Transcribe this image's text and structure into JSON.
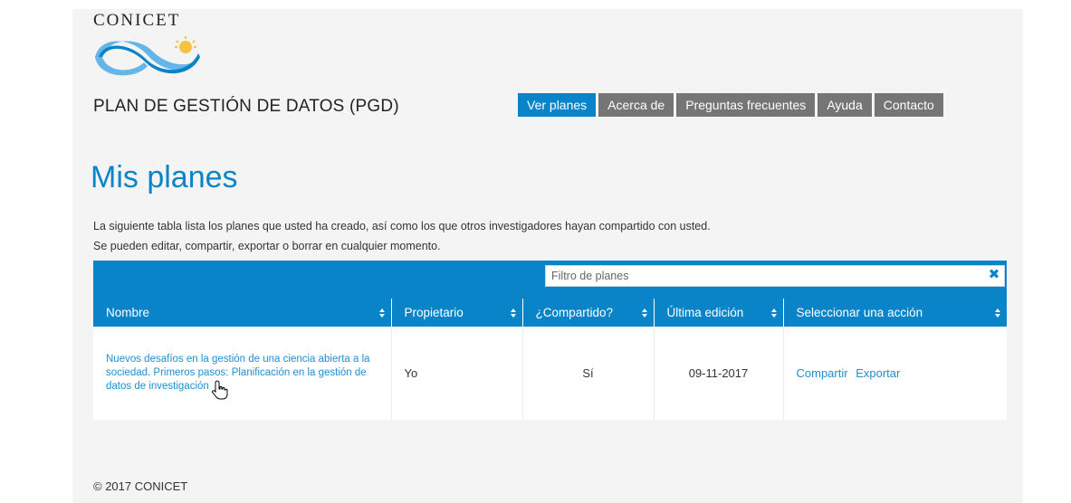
{
  "header": {
    "brand": "CONICET",
    "site_title": "PLAN DE GESTIÓN DE DATOS (PGD)",
    "nav": [
      {
        "label": "Ver planes",
        "active": true
      },
      {
        "label": "Acerca de",
        "active": false
      },
      {
        "label": "Preguntas frecuentes",
        "active": false
      },
      {
        "label": "Ayuda",
        "active": false
      },
      {
        "label": "Contacto",
        "active": false
      }
    ]
  },
  "main": {
    "title": "Mis planes",
    "intro_line1": "La siguiente tabla lista los planes que usted ha creado, así como los que otros investigadores hayan compartido con usted.",
    "intro_line2": "Se pueden editar, compartir, exportar o borrar en cualquier momento."
  },
  "table": {
    "filter_placeholder": "Filtro de planes",
    "filter_value": "",
    "columns": [
      "Nombre",
      "Propietario",
      "¿Compartido?",
      "Última edición",
      "Seleccionar una acción"
    ],
    "rows": [
      {
        "name": "Nuevos desafíos en la gestión de una ciencia abierta a la sociedad. Primeros pasos: Planificación en la gestión de datos de investigación",
        "owner": "Yo",
        "shared": "Sí",
        "last_edit": "09-11-2017",
        "actions": [
          "Compartir",
          "Exportar"
        ]
      }
    ]
  },
  "footer": {
    "copyright": "© 2017 CONICET"
  },
  "colors": {
    "accent": "#0984c9",
    "nav_inactive": "#757575",
    "link": "#1f8fd0",
    "page_bg": "#f4f4f4"
  },
  "icons": {
    "sort": "sort-both-icon",
    "clear": "close-icon",
    "cursor": "hand-pointer-icon"
  }
}
